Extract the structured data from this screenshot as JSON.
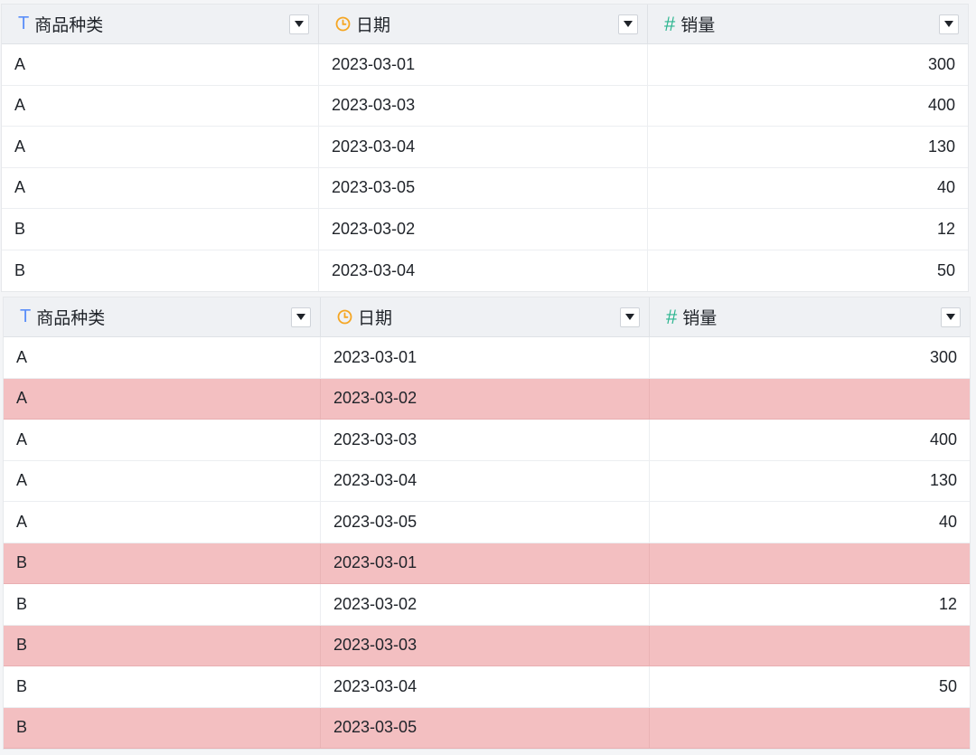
{
  "colors": {
    "text_icon": "#5b8ff9",
    "clock_icon": "#f5a623",
    "number_icon": "#2bb58f",
    "missing_row": "#f3bfc1"
  },
  "table1": {
    "columns": [
      {
        "icon": "text-type-icon",
        "glyph": "T",
        "label": "商品种类"
      },
      {
        "icon": "clock-icon",
        "glyph": "",
        "label": "日期"
      },
      {
        "icon": "hash-icon",
        "glyph": "#",
        "label": "销量"
      }
    ],
    "rows": [
      {
        "category": "A",
        "date": "2023-03-01",
        "sales": "300"
      },
      {
        "category": "A",
        "date": "2023-03-03",
        "sales": "400"
      },
      {
        "category": "A",
        "date": "2023-03-04",
        "sales": "130"
      },
      {
        "category": "A",
        "date": "2023-03-05",
        "sales": "40"
      },
      {
        "category": "B",
        "date": "2023-03-02",
        "sales": "12"
      },
      {
        "category": "B",
        "date": "2023-03-04",
        "sales": "50"
      }
    ]
  },
  "table2": {
    "columns": [
      {
        "icon": "text-type-icon",
        "glyph": "T",
        "label": "商品种类"
      },
      {
        "icon": "clock-icon",
        "glyph": "",
        "label": "日期"
      },
      {
        "icon": "hash-icon",
        "glyph": "#",
        "label": "销量"
      }
    ],
    "rows": [
      {
        "category": "A",
        "date": "2023-03-01",
        "sales": "300",
        "highlighted": false
      },
      {
        "category": "A",
        "date": "2023-03-02",
        "sales": "",
        "highlighted": true
      },
      {
        "category": "A",
        "date": "2023-03-03",
        "sales": "400",
        "highlighted": false
      },
      {
        "category": "A",
        "date": "2023-03-04",
        "sales": "130",
        "highlighted": false
      },
      {
        "category": "A",
        "date": "2023-03-05",
        "sales": "40",
        "highlighted": false
      },
      {
        "category": "B",
        "date": "2023-03-01",
        "sales": "",
        "highlighted": true
      },
      {
        "category": "B",
        "date": "2023-03-02",
        "sales": "12",
        "highlighted": false
      },
      {
        "category": "B",
        "date": "2023-03-03",
        "sales": "",
        "highlighted": true
      },
      {
        "category": "B",
        "date": "2023-03-04",
        "sales": "50",
        "highlighted": false
      },
      {
        "category": "B",
        "date": "2023-03-05",
        "sales": "",
        "highlighted": true
      }
    ]
  }
}
